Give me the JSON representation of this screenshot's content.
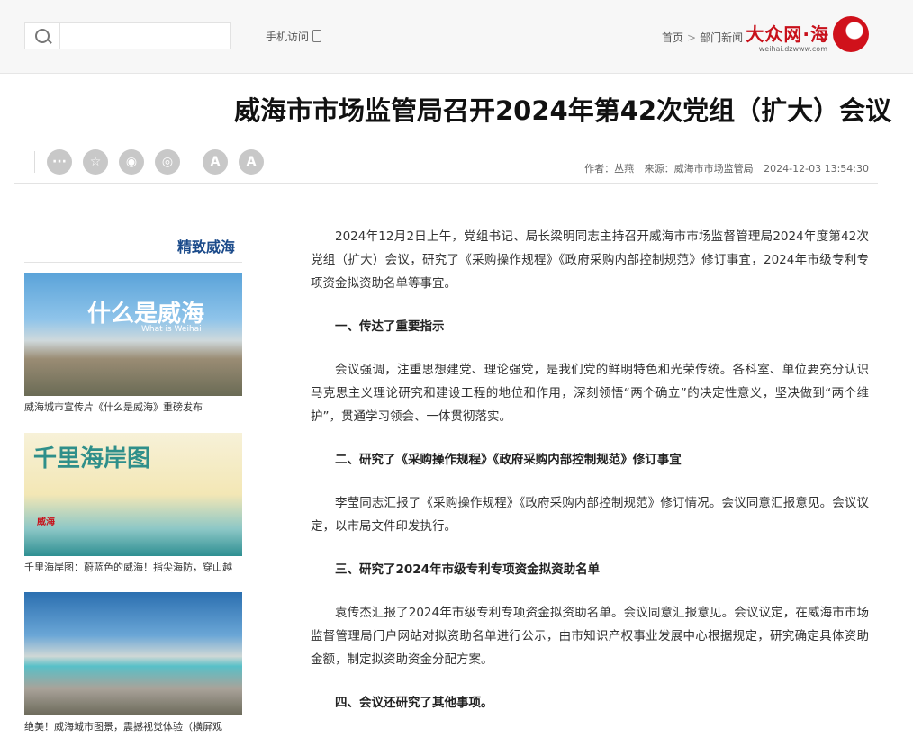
{
  "header": {
    "logo_text": "大众网·海",
    "logo_sub": "weihai.dzwww.com",
    "breadcrumb": [
      "首页",
      "部门新闻"
    ],
    "breadcrumb_sep": ">",
    "mobile_label": "手机访问",
    "search_placeholder": ""
  },
  "article": {
    "title": "威海市市场监管局召开2024年第42次党组（扩大）会议",
    "date": "2024-12-03 13:54:30",
    "source": "来源：威海市市场监管局",
    "author": "作者：丛燕",
    "tools": [
      "A-",
      "A+",
      "wechat",
      "weibo",
      "star",
      "more"
    ],
    "paragraphs": [
      {
        "type": "p",
        "text": "2024年12月2日上午，党组书记、局长梁明同志主持召开威海市市场监督管理局2024年度第42次党组（扩大）会议，研究了《采购操作规程》《政府采购内部控制规范》修订事宜，2024年市级专利专项资金拟资助名单等事宜。"
      },
      {
        "type": "h",
        "text": "一、传达了重要指示"
      },
      {
        "type": "p",
        "text": "会议强调，注重思想建党、理论强党，是我们党的鲜明特色和光荣传统。各科室、单位要充分认识马克思主义理论研究和建设工程的地位和作用，深刻领悟“两个确立”的决定性意义，坚决做到“两个维护”，贯通学习领会、一体贯彻落实。"
      },
      {
        "type": "h",
        "text": "二、研究了《采购操作规程》《政府采购内部控制规范》修订事宜"
      },
      {
        "type": "p",
        "text": "李莹同志汇报了《采购操作规程》《政府采购内部控制规范》修订情况。会议同意汇报意见。会议议定，以市局文件印发执行。"
      },
      {
        "type": "h",
        "text": "三、研究了2024年市级专利专项资金拟资助名单"
      },
      {
        "type": "p",
        "text": "袁传杰汇报了2024年市级专利专项资金拟资助名单。会议同意汇报意见。会议议定，在威海市市场监督管理局门户网站对拟资助名单进行公示，由市知识产权事业发展中心根据规定，研究确定具体资助金额，制定拟资助资金分配方案。"
      },
      {
        "type": "h",
        "text": "四、会议还研究了其他事项。"
      }
    ]
  },
  "sidebar": {
    "title": "精致威海",
    "cards": [
      {
        "caption": "威海城市宣传片《什么是威海》重磅发布",
        "img_text": "什么是威海",
        "img_sub": "What is Weihai"
      },
      {
        "caption": "千里海岸图：蔚蓝色的威海！指尖海防，穿山越",
        "img_text": "千里海岸图",
        "img_sub": "威海"
      },
      {
        "caption": "绝美！威海城市图景，震撼视觉体验（横屏观",
        "img_text": "",
        "img_sub": ""
      }
    ]
  },
  "colors": {
    "brand": "#c8101a",
    "link": "#1a4a8a",
    "icon": "#c8c8c8"
  }
}
